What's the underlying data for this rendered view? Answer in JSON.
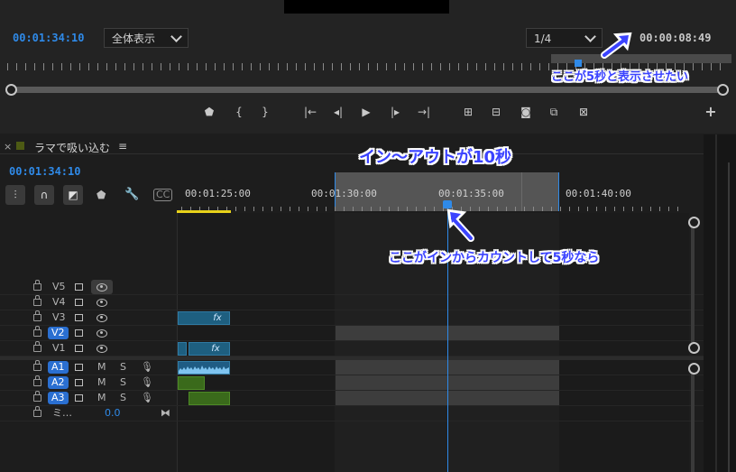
{
  "monitor": {
    "current_timecode": "00:01:34:10",
    "zoom_dropdown": "全体表示",
    "resolution_dropdown": "1/4",
    "duration_timecode": "00:00:08:49",
    "transport_icons": [
      "marker-icon",
      "mark-in-icon",
      "mark-out-icon",
      "go-to-in-icon",
      "step-back-icon",
      "play-icon",
      "step-forward-icon",
      "go-to-out-icon",
      "lift-icon",
      "extract-icon",
      "export-frame-icon",
      "comparison-view-icon",
      "safe-margins-icon",
      "add-button-icon"
    ]
  },
  "timeline": {
    "close_glyph": "×",
    "sequence_name": "ラマで吸い込む",
    "menu_glyph": "≡",
    "timecode": "00:01:34:10",
    "ruler_labels": [
      "00:01:25:00",
      "00:01:30:00",
      "00:01:35:00",
      "00:01:40:00"
    ],
    "tracks": [
      {
        "name": "V5",
        "kind": "video",
        "targeted": false
      },
      {
        "name": "V4",
        "kind": "video",
        "targeted": false
      },
      {
        "name": "V3",
        "kind": "video",
        "targeted": false
      },
      {
        "name": "V2",
        "kind": "video",
        "targeted": true
      },
      {
        "name": "V1",
        "kind": "video",
        "targeted": false
      },
      {
        "name": "A1",
        "kind": "audio",
        "targeted": true
      },
      {
        "name": "A2",
        "kind": "audio",
        "targeted": true
      },
      {
        "name": "A3",
        "kind": "audio",
        "targeted": true
      }
    ],
    "audio_m": "M",
    "audio_s": "S",
    "mix_label": "ミ…",
    "mix_value": "0.0",
    "fx_label": "fx"
  },
  "annotations": {
    "top_right": "ここが5秒と表示させたい",
    "in_out": "イン〜アウトが10秒",
    "playhead": "ここがインからカウントして5秒なら"
  },
  "colors": {
    "accent_blue": "#2f8ae8",
    "annotation": "#3b43ff",
    "clip_video": "#1e5f80",
    "clip_audio": "#3a6a1b"
  }
}
